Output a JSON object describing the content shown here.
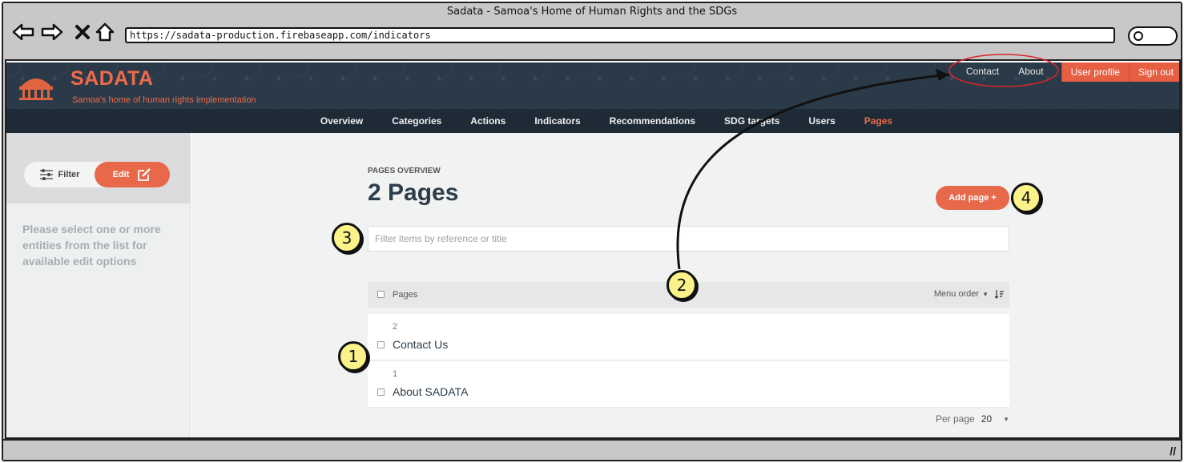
{
  "browser": {
    "title": "Sadata - Samoa's Home of Human Rights and the SDGs",
    "url": "https://sadata-production.firebaseapp.com/indicators"
  },
  "header": {
    "brand": "SADATA",
    "tagline": "Samoa's home of human rights implementation",
    "links": {
      "contact": "Contact",
      "about": "About"
    },
    "buttons": {
      "profile": "User profile",
      "signout": "Sign out"
    },
    "accent": "#ee6a4a",
    "bg": "#2b3a48"
  },
  "nav": {
    "items": [
      "Overview",
      "Categories",
      "Actions",
      "Indicators",
      "Recommendations",
      "SDG targets",
      "Users",
      "Pages"
    ],
    "active": "Pages"
  },
  "sidebar": {
    "filter_label": "Filter",
    "edit_label": "Edit",
    "hint": "Please select one or more entities from the list for available edit options"
  },
  "main": {
    "overline": "PAGES OVERVIEW",
    "title": "2 Pages",
    "add_button": "Add page +",
    "filter_placeholder": "Filter items by reference or title",
    "list_header": "Pages",
    "sort_label": "Menu order",
    "rows": [
      {
        "num": "2",
        "title": "Contact Us"
      },
      {
        "num": "1",
        "title": "About SADATA"
      }
    ],
    "perpage_label": "Per page",
    "perpage_value": "20"
  },
  "annotations": [
    "1",
    "2",
    "3",
    "4"
  ]
}
